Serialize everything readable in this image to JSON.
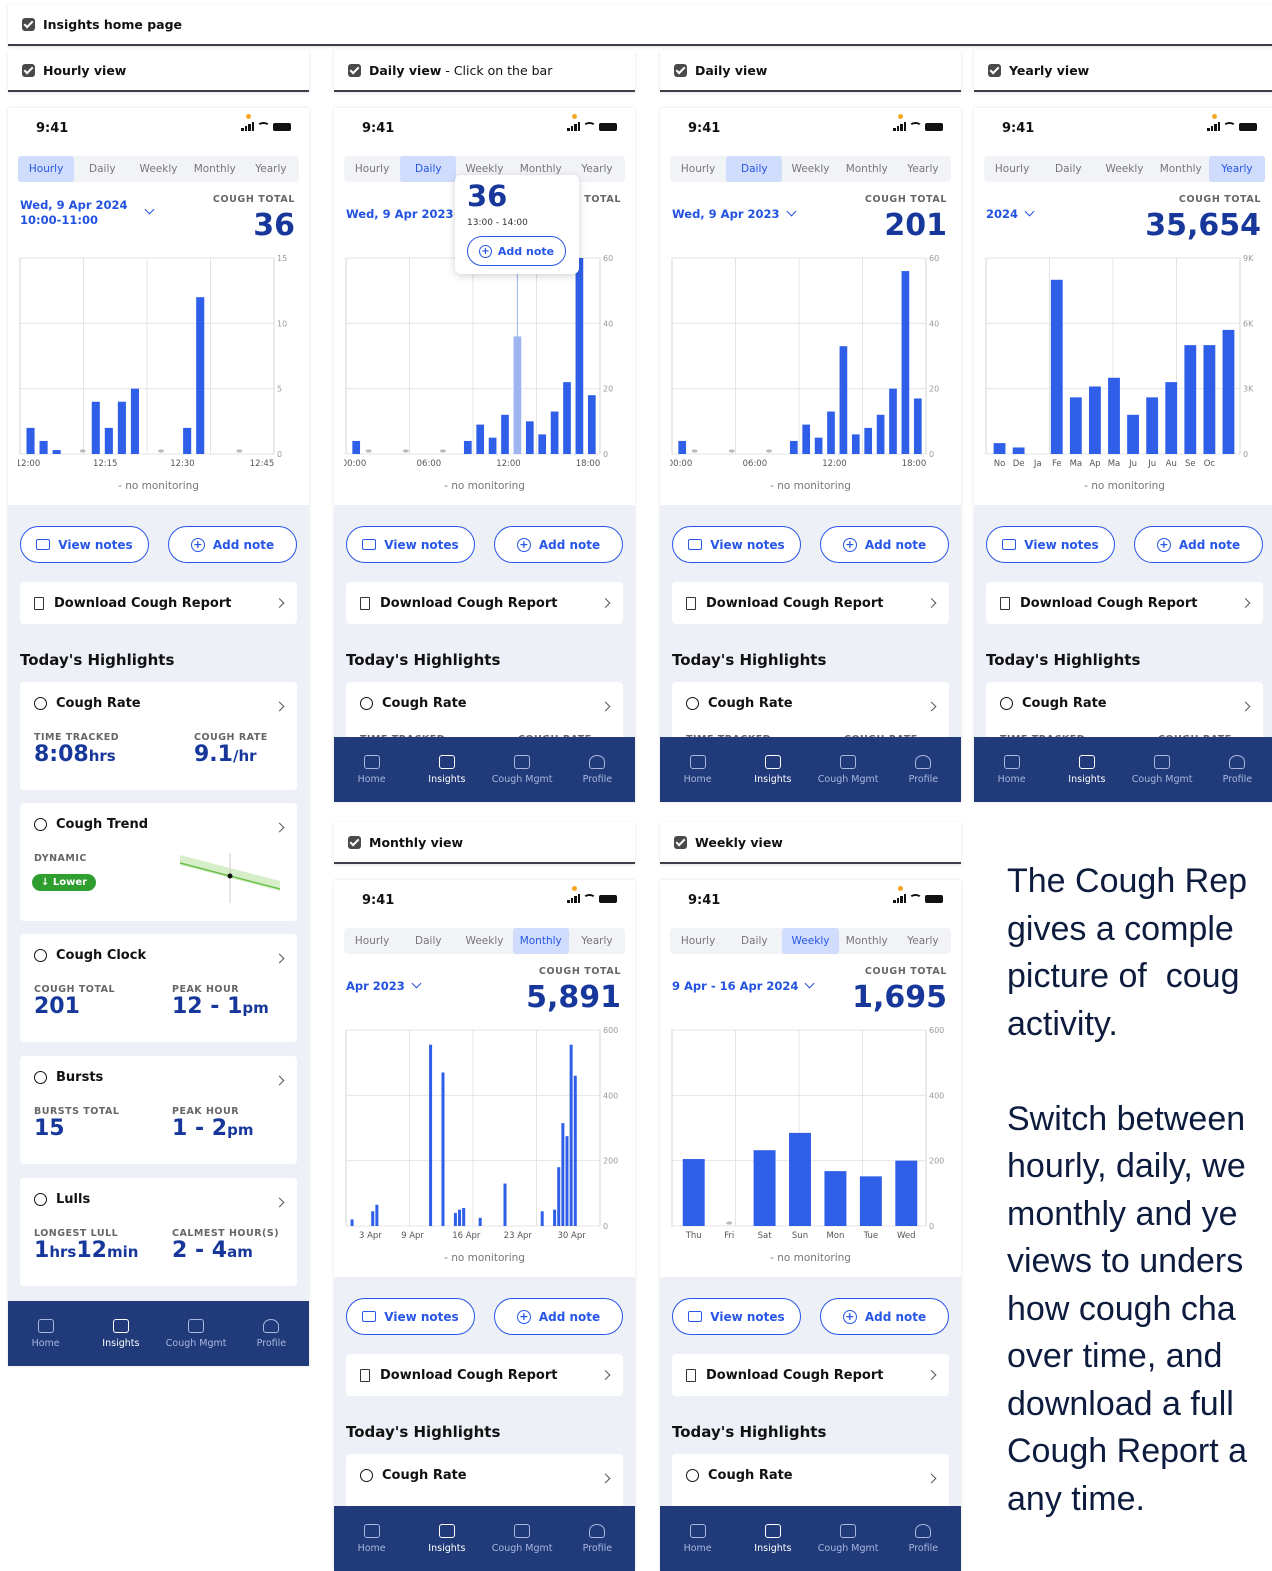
{
  "page_label": "Insights home page",
  "colors": {
    "bar": "#2f5fe8",
    "bar_light": "#9db4f0",
    "navy": "#213a7a",
    "value": "#17389a",
    "green": "#2e9e2e"
  },
  "tabs": [
    "Hourly",
    "Daily",
    "Weekly",
    "Monthly",
    "Yearly"
  ],
  "status_time": "9:41",
  "common": {
    "view_notes": "View notes",
    "add_note": "Add note",
    "download": "Download Cough Report",
    "highlights": "Today's Highlights",
    "cough_rate": "Cough Rate",
    "cough_total_label": "COUGH TOTAL",
    "no_monitoring": "- no monitoring",
    "peek_left": "TIME TRACKED",
    "peek_right": "COUGH RATE"
  },
  "nav": [
    "Home",
    "Insights",
    "Cough Mgmt",
    "Profile"
  ],
  "screens": [
    {
      "label": "Hourly view",
      "sub": "",
      "tab": "Hourly",
      "date": [
        "Wed, 9 Apr 2024",
        "10:00-11:00"
      ],
      "total": "36",
      "chart_data": {
        "type": "bar",
        "values": [
          2,
          1,
          0.3,
          0,
          0,
          4,
          2,
          4,
          5,
          0,
          0,
          0,
          2,
          12,
          0,
          0,
          0,
          0,
          0
        ],
        "ylim": [
          0,
          15
        ],
        "yticks": [
          "15",
          "10",
          "5",
          "0"
        ],
        "xticks": [
          "12:00",
          "12:15",
          "12:30",
          "12:45"
        ],
        "xtick_pos": [
          0,
          0.33,
          0.66,
          1
        ]
      }
    },
    {
      "label": "Daily view",
      "sub": "- Click on the bar",
      "tab": "Daily",
      "date": [
        "Wed, 9 Apr 2023"
      ],
      "total": "",
      "total_peek": "TOTAL",
      "tooltip": {
        "value": "36",
        "range": "13:00 - 14:00",
        "button": "Add note"
      },
      "chart_data": {
        "type": "bar",
        "values": [
          4,
          0,
          0,
          0,
          0,
          0,
          0,
          0,
          0,
          4,
          9,
          5,
          12,
          36,
          10,
          6,
          13,
          22,
          64,
          18
        ],
        "highlight": 13,
        "ylim": [
          0,
          60
        ],
        "yticks": [
          "60",
          "40",
          "20",
          "0"
        ],
        "xticks": [
          "00:00",
          "06:00",
          "12:00",
          "18:00"
        ],
        "xtick_pos": [
          0,
          0.32,
          0.66,
          1
        ]
      }
    },
    {
      "label": "Daily view",
      "sub": "",
      "tab": "Daily",
      "date": [
        "Wed, 9 Apr 2023"
      ],
      "total": "201",
      "chart_data": {
        "type": "bar",
        "values": [
          4,
          0,
          0,
          0,
          0,
          0,
          0,
          0,
          0,
          4,
          9,
          5,
          13,
          33,
          6,
          8,
          12,
          20,
          56,
          17
        ],
        "ylim": [
          0,
          60
        ],
        "yticks": [
          "60",
          "40",
          "20",
          "0"
        ],
        "xticks": [
          "00:00",
          "06:00",
          "12:00",
          "18:00"
        ],
        "xtick_pos": [
          0,
          0.32,
          0.66,
          1
        ]
      }
    },
    {
      "label": "Yearly view",
      "sub": "",
      "tab": "Yearly",
      "date": [
        "2024"
      ],
      "total": "35,654",
      "chart_data": {
        "type": "bar",
        "values": [
          500,
          300,
          0,
          8000,
          2600,
          3100,
          3500,
          1800,
          2600,
          3300,
          5000,
          5000,
          5700
        ],
        "ylim": [
          0,
          9000
        ],
        "yticks": [
          "9K",
          "6K",
          "3K",
          "0"
        ],
        "xticks": [
          "No",
          "De",
          "Ja",
          "Fe",
          "Ma",
          "Ap",
          "Ma",
          "Ju",
          "Ju",
          "Au",
          "Se",
          "Oc"
        ]
      }
    },
    {
      "label": "Monthly view",
      "sub": "",
      "tab": "Monthly",
      "date": [
        "Apr 2023"
      ],
      "total": "5,891",
      "chart_data": {
        "type": "bar",
        "values": [
          20,
          0,
          0,
          0,
          0,
          45,
          65,
          0,
          0,
          0,
          0,
          0,
          0,
          0,
          0,
          0,
          0,
          0,
          0,
          555,
          0,
          0,
          470,
          0,
          0,
          40,
          50,
          55,
          0,
          0,
          0,
          25,
          0,
          0,
          0,
          0,
          0,
          130,
          0,
          0,
          0,
          0,
          0,
          0,
          0,
          0,
          45,
          0,
          0,
          50,
          180,
          315,
          275,
          555,
          460,
          0,
          0,
          0,
          0,
          0
        ],
        "ylim": [
          0,
          600
        ],
        "yticks": [
          "600",
          "400",
          "200",
          "0"
        ],
        "xticks": [
          "3 Apr",
          "9 Apr",
          "16 Apr",
          "23 Apr",
          "30 Apr"
        ],
        "xtick_pos": [
          0.07,
          0.25,
          0.48,
          0.7,
          0.93
        ]
      }
    },
    {
      "label": "Weekly view",
      "sub": "",
      "tab": "Weekly",
      "date": [
        "9 Apr - 16 Apr 2024"
      ],
      "total": "1,695",
      "chart_data": {
        "type": "bar",
        "values": [
          205,
          0,
          232,
          285,
          168,
          152,
          200
        ],
        "ylim": [
          0,
          600
        ],
        "yticks": [
          "600",
          "400",
          "200",
          "0"
        ],
        "xticks": [
          "Thu",
          "Fri",
          "Sat",
          "Sun",
          "Mon",
          "Tue",
          "Wed"
        ]
      }
    }
  ],
  "first": {
    "time_tracked_label": "TIME TRACKED",
    "time_tracked": "8:08",
    "time_unit": "hrs",
    "cough_rate_label": "COUGH RATE",
    "cough_rate": "9.1",
    "cough_rate_unit": "/hr",
    "trend_title": "Cough Trend",
    "trend_sub": "DYNAMIC",
    "trend_pill": "↓ Lower",
    "clock_title": "Cough Clock",
    "clock_l": "COUGH TOTAL",
    "clock_lv": "201",
    "clock_r": "PEAK HOUR",
    "clock_rv": "12 - 1",
    "clock_ru": "pm",
    "burst_title": "Bursts",
    "burst_l": "BURSTS TOTAL",
    "burst_lv": "15",
    "burst_r": "PEAK HOUR",
    "burst_rv": "1 - 2",
    "burst_ru": "pm",
    "lull_title": "Lulls",
    "lull_l": "LONGEST LULL",
    "lull_lv1": "1",
    "lull_lu1": "hrs",
    "lull_lv2": "12",
    "lull_lu2": "min",
    "lull_r": "CALMEST HOUR(S)",
    "lull_rv": "2 - 4",
    "lull_ru": "am"
  },
  "side_text": [
    "The Cough Rep",
    "gives a comple",
    "picture of  coug",
    "activity.",
    "",
    "Switch between",
    "hourly, daily, we",
    "monthly and ye",
    "views to unders",
    "how cough cha",
    "over time, and",
    "download a full",
    "Cough Report a",
    "any time."
  ]
}
